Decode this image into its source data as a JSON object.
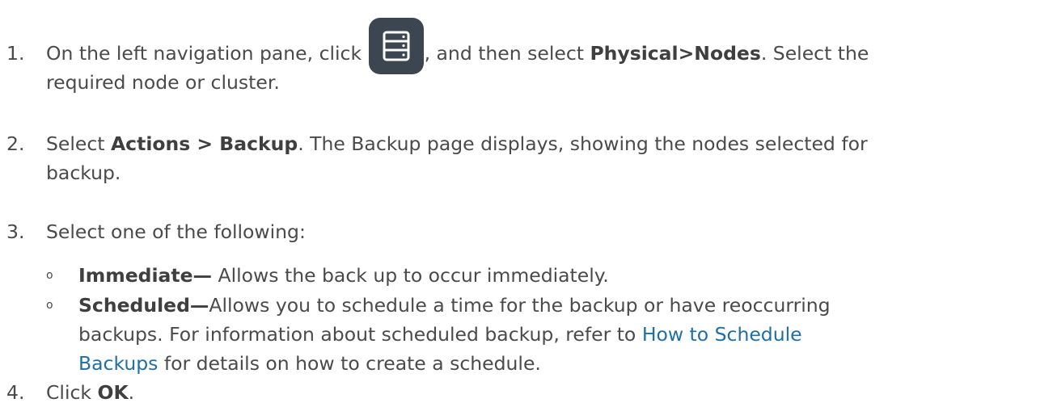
{
  "steps": [
    {
      "number": "1.",
      "line1_a": "On the left navigation pane, click",
      "icon": "server-nodes-icon",
      "line1_b": ", and then select",
      "bold": "Physical>Nodes",
      "line1_c": ". Select the",
      "line2": "required node or cluster."
    },
    {
      "number": "2.",
      "a": "Select",
      "bold": "Actions > Backup",
      "line1_b": ". The Backup page displays, showing the nodes selected for",
      "line2": "backup."
    },
    {
      "number": "3.",
      "text": "Select one of the following:",
      "options": [
        {
          "bullet": "o",
          "bold": "Immediate—",
          "text": " Allows the back up to occur immediately."
        },
        {
          "bullet": "o",
          "bold": "Scheduled—",
          "text_line1": "Allows you to schedule a time for the backup or have reoccurring",
          "line2_a": "backups. For information about scheduled backup, refer to",
          "link_part1": "How to Schedule",
          "link_part2": "Backups",
          "line3_b": " for details on how to create a schedule."
        }
      ]
    },
    {
      "number": "4.",
      "a": "Click",
      "bold": "OK",
      "b": "."
    }
  ],
  "colors": {
    "text": "#4a4a4a",
    "link": "#1f6fa6",
    "icon_bg": "#3b4650"
  }
}
